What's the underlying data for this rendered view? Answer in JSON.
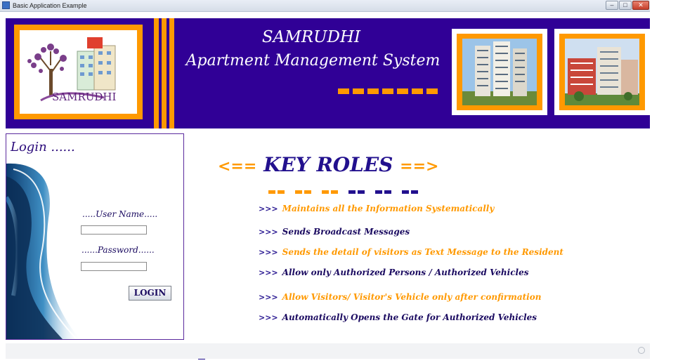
{
  "window": {
    "title": "Basic Application Example",
    "minimize_label": "–",
    "maximize_label": "□",
    "close_label": "✕"
  },
  "header": {
    "title_line1": "SAMRUDHI",
    "title_line2": "Apartment Management System",
    "logo_text": "SAMRUDHI"
  },
  "login": {
    "title": "Login ......",
    "username_label": ".....User Name.....",
    "username_value": "",
    "password_label": "......Password......",
    "password_value": "",
    "button_label": "LOGIN"
  },
  "roles": {
    "arrow_left": "<==",
    "title": "KEY ROLES",
    "arrow_right": "==>",
    "bullet": ">>>",
    "items": [
      "Maintains all the Information Systematically",
      "Sends Broadcast Messages",
      "Sends the detail of visitors as Text Message to the Resident",
      "Allow only Authorized Persons / Authorized Vehicles",
      "Allow Visitors/ Visitor's Vehicle only after confirmation",
      "Automatically Opens the Gate for Authorized Vehicles"
    ]
  },
  "colors": {
    "header_bg": "#300096",
    "accent_orange": "#ff9900",
    "navy_text": "#1a0a60"
  }
}
